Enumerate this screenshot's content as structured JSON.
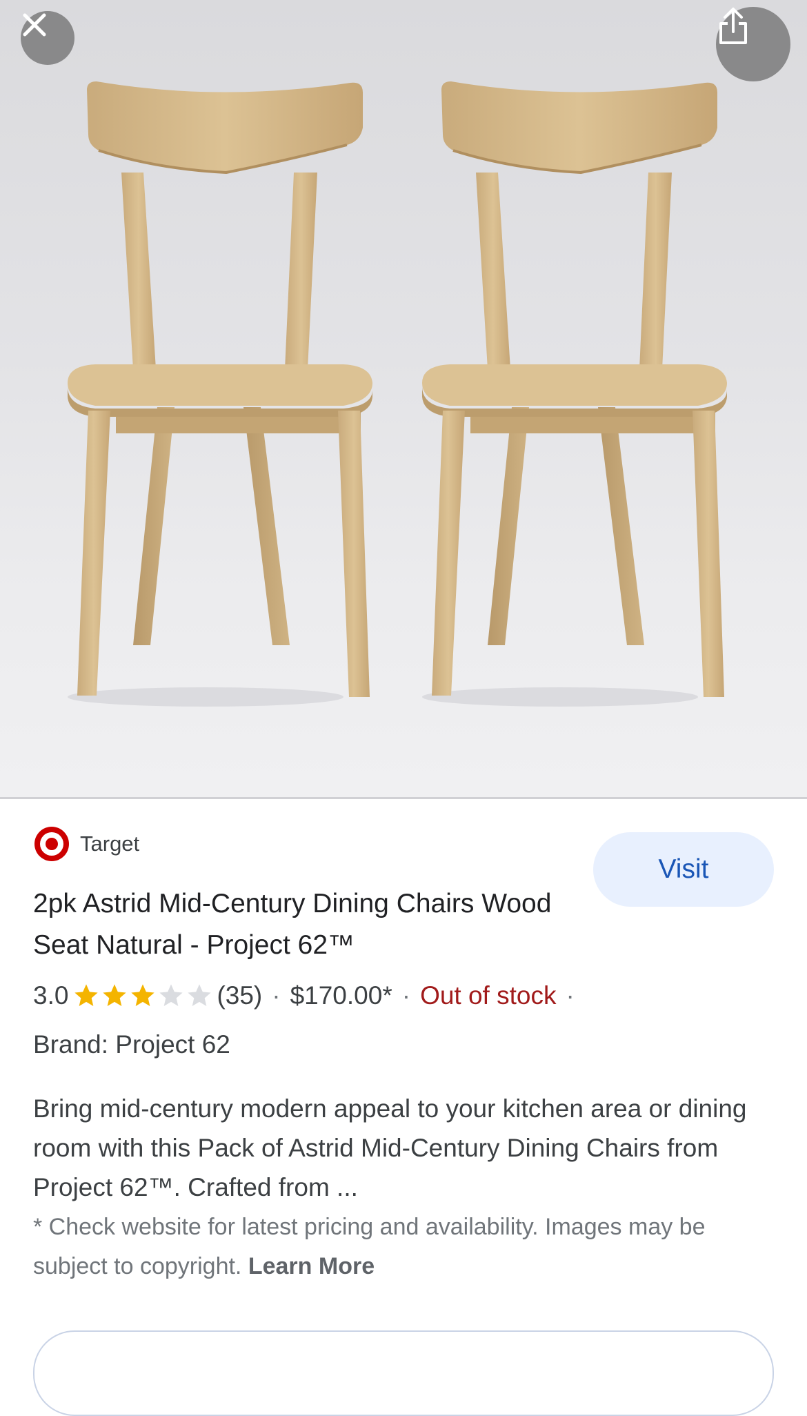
{
  "hero": {
    "image_alt": "two wooden mid-century dining chairs",
    "close_icon": "close-icon",
    "share_icon": "share-icon"
  },
  "product": {
    "source_icon": "target-logo-icon",
    "source_name": "Target",
    "visit_label": "Visit",
    "title": "2pk Astrid Mid-Century Dining Chairs Wood Seat Natural - Project 62™",
    "rating_text": "3.0",
    "rating_value": 3.0,
    "rating_max": 5,
    "review_count": "(35)",
    "separator": "·",
    "price": "$170.00*",
    "stock_status": "Out of stock",
    "brand": "Brand: Project 62",
    "description": "Bring mid-century modern appeal to your kitchen area or dining room with this Pack of Astrid Mid-Century Dining Chairs from Project 62™. Crafted from ...",
    "disclaimer": "* Check website for latest pricing and availability. Images may be subject to copyright.",
    "learn_more": "Learn More"
  },
  "colors": {
    "accent": "#1a56b6",
    "visit_bg": "#e8f0fe",
    "star_filled": "#f4b400",
    "star_empty": "#dadce0",
    "out_of_stock": "#a11b1b",
    "target_red": "#cc0000"
  }
}
